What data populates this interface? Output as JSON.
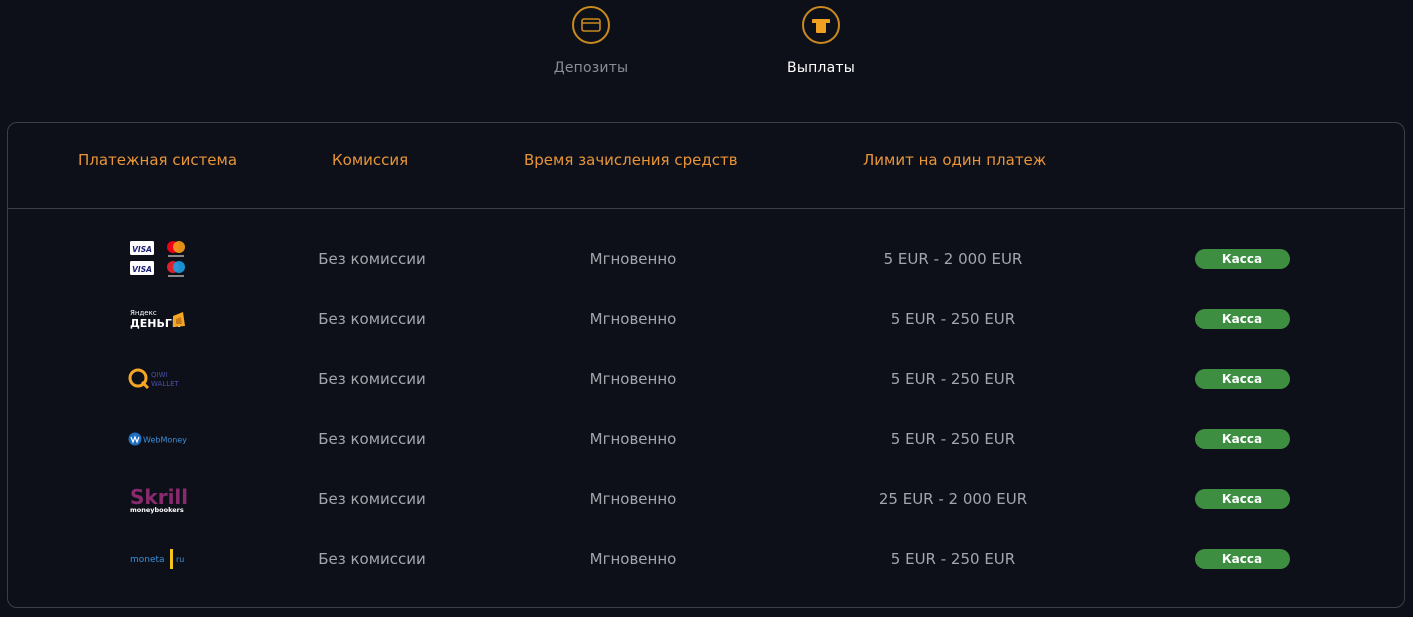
{
  "tabs": {
    "deposits": {
      "label": "Депозиты",
      "icon": "card-icon",
      "active": false
    },
    "payouts": {
      "label": "Выплаты",
      "icon": "wallet-icon",
      "active": true
    }
  },
  "table": {
    "headers": {
      "system": "Платежная система",
      "fee": "Комиссия",
      "time": "Время зачисления средств",
      "limit": "Лимит на один платеж"
    },
    "rows": [
      {
        "system": "Visa / Mastercard / Visa / Maestro",
        "fee": "Без комиссии",
        "time": "Мгновенно",
        "limit": "5 EUR - 2 000 EUR",
        "action": "Касса"
      },
      {
        "system": "Яндекс Деньги",
        "fee": "Без комиссии",
        "time": "Мгновенно",
        "limit": "5 EUR - 250 EUR",
        "action": "Касса"
      },
      {
        "system": "QIWI WALLET",
        "fee": "Без комиссии",
        "time": "Мгновенно",
        "limit": "5 EUR - 250 EUR",
        "action": "Касса"
      },
      {
        "system": "WebMoney",
        "fee": "Без комиссии",
        "time": "Мгновенно",
        "limit": "5 EUR - 250 EUR",
        "action": "Касса"
      },
      {
        "system": "Skrill moneybookers",
        "fee": "Без комиссии",
        "time": "Мгновенно",
        "limit": "25 EUR - 2 000 EUR",
        "action": "Касса"
      },
      {
        "system": "moneta ru",
        "fee": "Без комиссии",
        "time": "Мгновенно",
        "limit": "5 EUR - 250 EUR",
        "action": "Касса"
      }
    ],
    "logos": {
      "visa": "VISA",
      "yandex_top": "Яндекс",
      "yandex_bottom": "ДЕНЬГИ",
      "qiwi_top": "QIWI",
      "qiwi_bottom": "WALLET",
      "webmoney": "WebMoney",
      "skrill": "Skrill",
      "skrill_sub": "moneybookers",
      "moneta": "moneta",
      "moneta_ru": "ru"
    }
  },
  "colors": {
    "background": "#0d1018",
    "accent": "#e8953a",
    "button": "#3e8e42",
    "border": "#3a3e48"
  }
}
